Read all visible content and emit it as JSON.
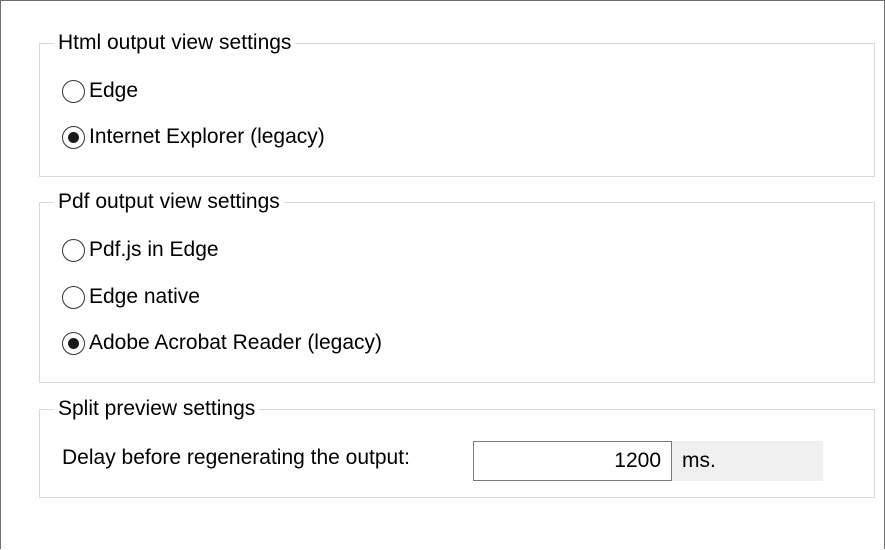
{
  "html_group": {
    "title": "Html output view settings",
    "options": [
      {
        "label": "Edge",
        "selected": false
      },
      {
        "label": "Internet Explorer (legacy)",
        "selected": true
      }
    ]
  },
  "pdf_group": {
    "title": "Pdf output view settings",
    "options": [
      {
        "label": "Pdf.js in Edge",
        "selected": false
      },
      {
        "label": "Edge native",
        "selected": false
      },
      {
        "label": "Adobe Acrobat Reader (legacy)",
        "selected": true
      }
    ]
  },
  "split_group": {
    "title": "Split preview settings",
    "delay_label": "Delay before regenerating the output:",
    "delay_value": "1200",
    "delay_unit": "ms."
  },
  "colors": {
    "group_border": "#d9d9d9",
    "input_border": "#7a7a7a",
    "unit_strip": "#f0f0f0"
  }
}
